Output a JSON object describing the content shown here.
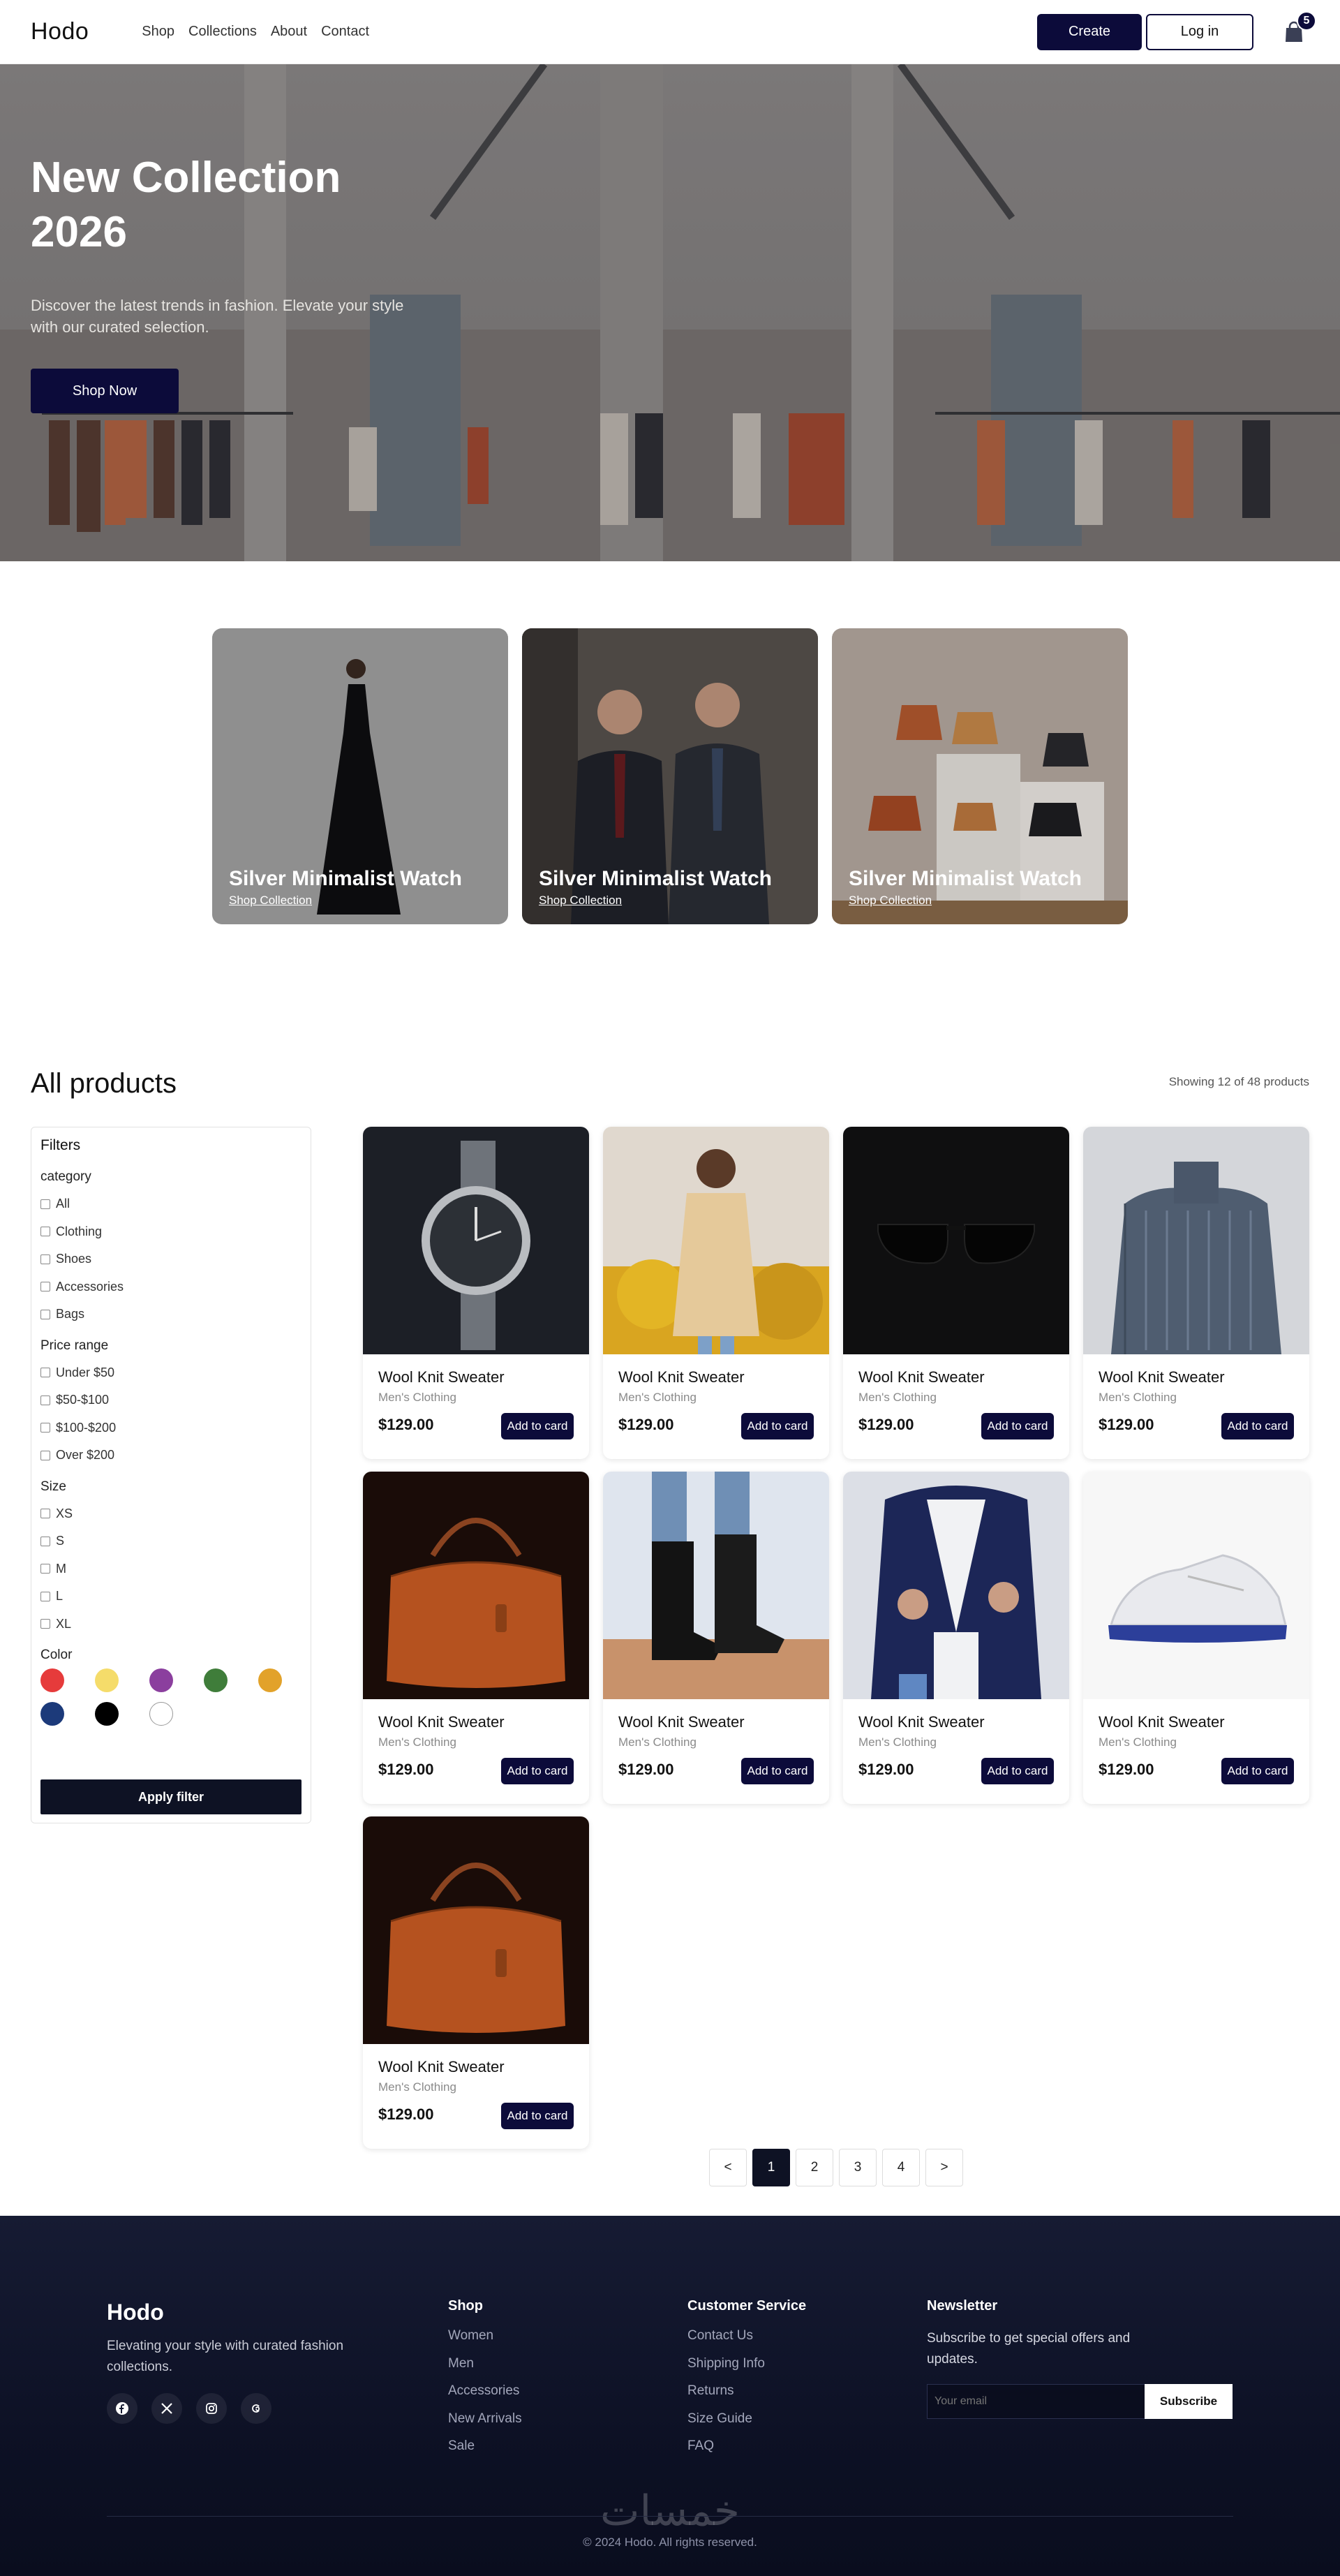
{
  "nav": {
    "logo": "Hodo",
    "links": [
      "Shop",
      "Collections",
      "About",
      "Contact"
    ],
    "create_label": "Create",
    "login_label": "Log in",
    "cart_count": "5"
  },
  "hero": {
    "title": "New Collection 2026",
    "subtitle": "Discover the latest trends in fashion. Elevate your style with our curated selection.",
    "cta": "Shop Now"
  },
  "collections": [
    {
      "title": "Silver Minimalist Watch",
      "link": "Shop Collection"
    },
    {
      "title": "Silver Minimalist Watch",
      "link": "Shop Collection"
    },
    {
      "title": "Silver Minimalist Watch",
      "link": "Shop Collection"
    }
  ],
  "products_section": {
    "title": "All products",
    "showing": "Showing 12 of 48 products"
  },
  "filters": {
    "title": "Filters",
    "category_title": "category",
    "categories": [
      "All",
      "Clothing",
      "Shoes",
      "Accessories",
      "Bags"
    ],
    "price_title": "Price range",
    "prices": [
      "Under $50",
      "$50-$100",
      "$100-$200",
      "Over $200"
    ],
    "size_title": "Size",
    "sizes": [
      "XS",
      "S",
      "M",
      "L",
      "XL"
    ],
    "color_title": "Color",
    "colors": [
      "#e63b3b",
      "#f5dc6a",
      "#8b3f9e",
      "#3f7d3a",
      "#e2a22a",
      "#1c3a7a",
      "#000000",
      "#ffffff"
    ],
    "apply_label": "Apply filter"
  },
  "products": [
    {
      "name": "Wool Knit Sweater",
      "category": "Men's Clothing",
      "price": "$129.00",
      "add": "Add to card",
      "image": "watch"
    },
    {
      "name": "Wool Knit Sweater",
      "category": "Men's Clothing",
      "price": "$129.00",
      "add": "Add to card",
      "image": "coat"
    },
    {
      "name": "Wool Knit Sweater",
      "category": "Men's Clothing",
      "price": "$129.00",
      "add": "Add to card",
      "image": "sunglasses"
    },
    {
      "name": "Wool Knit Sweater",
      "category": "Men's Clothing",
      "price": "$129.00",
      "add": "Add to card",
      "image": "sweater"
    },
    {
      "name": "Wool Knit Sweater",
      "category": "Men's Clothing",
      "price": "$129.00",
      "add": "Add to card",
      "image": "bag"
    },
    {
      "name": "Wool Knit Sweater",
      "category": "Men's Clothing",
      "price": "$129.00",
      "add": "Add to card",
      "image": "boots"
    },
    {
      "name": "Wool Knit Sweater",
      "category": "Men's Clothing",
      "price": "$129.00",
      "add": "Add to card",
      "image": "blazer"
    },
    {
      "name": "Wool Knit Sweater",
      "category": "Men's Clothing",
      "price": "$129.00",
      "add": "Add to card",
      "image": "sneaker"
    },
    {
      "name": "Wool Knit Sweater",
      "category": "Men's Clothing",
      "price": "$129.00",
      "add": "Add to card",
      "image": "bag"
    }
  ],
  "pagination": {
    "prev": "<",
    "pages": [
      "1",
      "2",
      "3",
      "4"
    ],
    "next": ">",
    "current": "1"
  },
  "footer": {
    "logo": "Hodo",
    "tagline": "Elevating your style with curated fashion collections.",
    "socials": [
      "facebook-icon",
      "x-icon",
      "instagram-icon",
      "threads-icon"
    ],
    "shop_title": "Shop",
    "shop_links": [
      "Women",
      "Men",
      "Accessories",
      "New Arrivals",
      "Sale"
    ],
    "service_title": "Customer Service",
    "service_links": [
      "Contact Us",
      "Shipping Info",
      "Returns",
      "Size Guide",
      "FAQ"
    ],
    "newsletter_title": "Newsletter",
    "newsletter_text": "Subscribe to get special offers and updates.",
    "email_placeholder": "Your email",
    "subscribe_label": "Subscribe",
    "watermark": "خمسات",
    "copyright": "© 2024 Hodo. All rights reserved."
  }
}
